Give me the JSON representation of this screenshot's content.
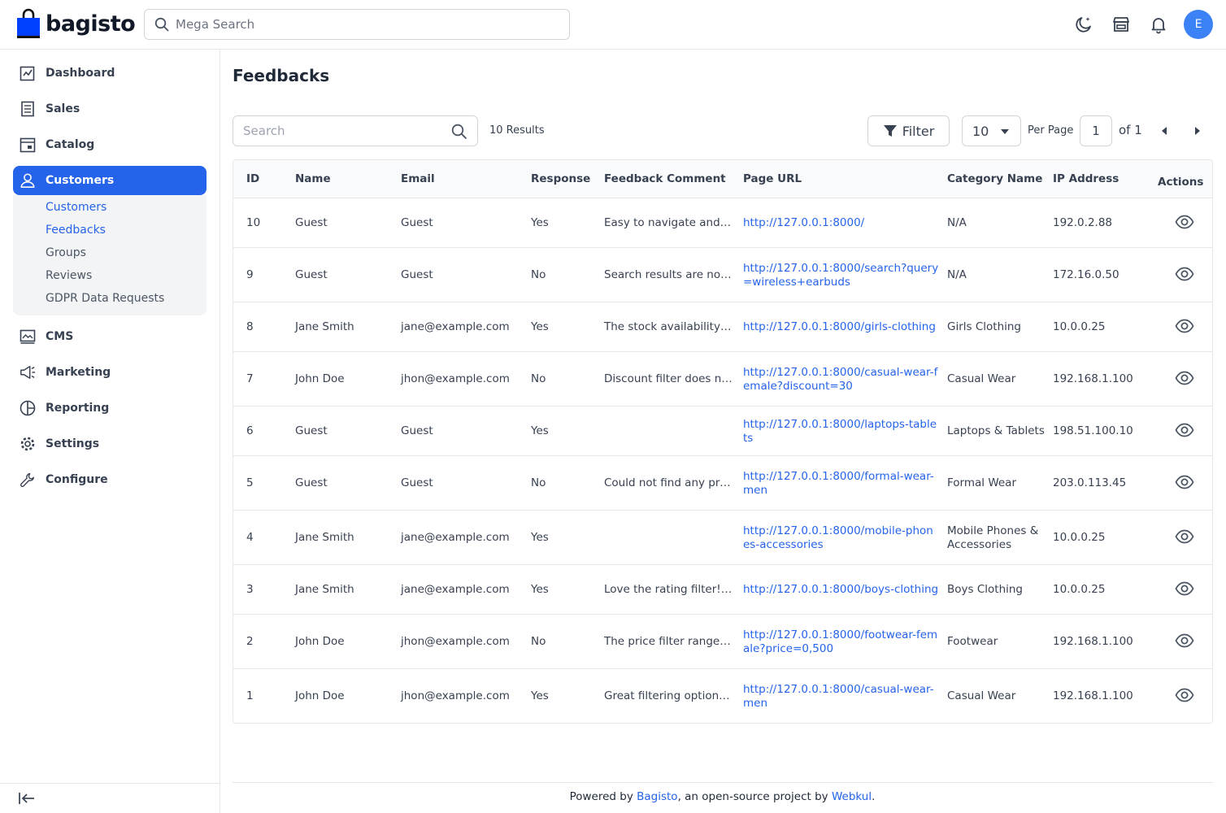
{
  "header": {
    "logo_text": "bagisto",
    "search_placeholder": "Mega Search",
    "avatar_initial": "E",
    "brand_color": "#0041ff"
  },
  "sidebar": {
    "items": [
      {
        "label": "Dashboard",
        "icon": "dashboard-icon"
      },
      {
        "label": "Sales",
        "icon": "sales-icon"
      },
      {
        "label": "Catalog",
        "icon": "catalog-icon"
      },
      {
        "label": "Customers",
        "icon": "customers-icon",
        "active": true
      },
      {
        "label": "CMS",
        "icon": "cms-icon"
      },
      {
        "label": "Marketing",
        "icon": "marketing-icon"
      },
      {
        "label": "Reporting",
        "icon": "reporting-icon"
      },
      {
        "label": "Settings",
        "icon": "settings-icon"
      },
      {
        "label": "Configure",
        "icon": "configure-icon"
      }
    ],
    "submenu": [
      {
        "label": "Customers"
      },
      {
        "label": "Feedbacks"
      },
      {
        "label": "Groups"
      },
      {
        "label": "Reviews"
      },
      {
        "label": "GDPR Data Requests"
      }
    ],
    "active_color": "#2563eb"
  },
  "main": {
    "title": "Feedbacks",
    "search_placeholder": "Search",
    "results_text": "10 Results",
    "filter_label": "Filter",
    "per_page_value": "10",
    "per_page_label": "Per Page",
    "page_value": "1",
    "page_of": "of 1"
  },
  "table": {
    "columns": [
      "ID",
      "Name",
      "Email",
      "Response",
      "Feedback Comment",
      "Page URL",
      "Category Name",
      "IP Address",
      "Actions"
    ],
    "rows": [
      {
        "id": "10",
        "name": "Guest",
        "email": "Guest",
        "response": "Yes",
        "comment": "Easy to navigate and fil…",
        "url": "http://127.0.0.1:8000/",
        "category": "N/A",
        "ip": "192.0.2.88"
      },
      {
        "id": "9",
        "name": "Guest",
        "email": "Guest",
        "response": "No",
        "comment": "Search results are not …",
        "url": "http://127.0.0.1:8000/search?query=wireless+earbuds",
        "category": "N/A",
        "ip": "172.16.0.50"
      },
      {
        "id": "8",
        "name": "Jane Smith",
        "email": "jane@example.com",
        "response": "Yes",
        "comment": "The stock availability fi…",
        "url": "http://127.0.0.1:8000/girls-clothing",
        "category": "Girls Clothing",
        "ip": "10.0.0.25"
      },
      {
        "id": "7",
        "name": "John Doe",
        "email": "jhon@example.com",
        "response": "No",
        "comment": "Discount filter does no…",
        "url": "http://127.0.0.1:8000/casual-wear-female?discount=30",
        "category": "Casual Wear",
        "ip": "192.168.1.100"
      },
      {
        "id": "6",
        "name": "Guest",
        "email": "Guest",
        "response": "Yes",
        "comment": "",
        "url": "http://127.0.0.1:8000/laptops-tablets",
        "category": "Laptops & Tablets",
        "ip": "198.51.100.10"
      },
      {
        "id": "5",
        "name": "Guest",
        "email": "Guest",
        "response": "No",
        "comment": "Could not find any pro…",
        "url": "http://127.0.0.1:8000/formal-wear-men",
        "category": "Formal Wear",
        "ip": "203.0.113.45"
      },
      {
        "id": "4",
        "name": "Jane Smith",
        "email": "jane@example.com",
        "response": "Yes",
        "comment": "",
        "url": "http://127.0.0.1:8000/mobile-phones-accessories",
        "category": "Mobile Phones & Accessories",
        "ip": "10.0.0.25"
      },
      {
        "id": "3",
        "name": "Jane Smith",
        "email": "jane@example.com",
        "response": "Yes",
        "comment": "Love the rating filter! I …",
        "url": "http://127.0.0.1:8000/boys-clothing",
        "category": "Boys Clothing",
        "ip": "10.0.0.25"
      },
      {
        "id": "2",
        "name": "John Doe",
        "email": "jhon@example.com",
        "response": "No",
        "comment": "The price filter range is…",
        "url": "http://127.0.0.1:8000/footwear-female?price=0,500",
        "category": "Footwear",
        "ip": "192.168.1.100"
      },
      {
        "id": "1",
        "name": "John Doe",
        "email": "jhon@example.com",
        "response": "Yes",
        "comment": "Great filtering options!…",
        "url": "http://127.0.0.1:8000/casual-wear-men",
        "category": "Casual Wear",
        "ip": "192.168.1.100"
      }
    ]
  },
  "footer": {
    "prefix": "Powered by ",
    "link1": "Bagisto",
    "middle": ", an open-source project by ",
    "link2": "Webkul",
    "suffix": "."
  }
}
